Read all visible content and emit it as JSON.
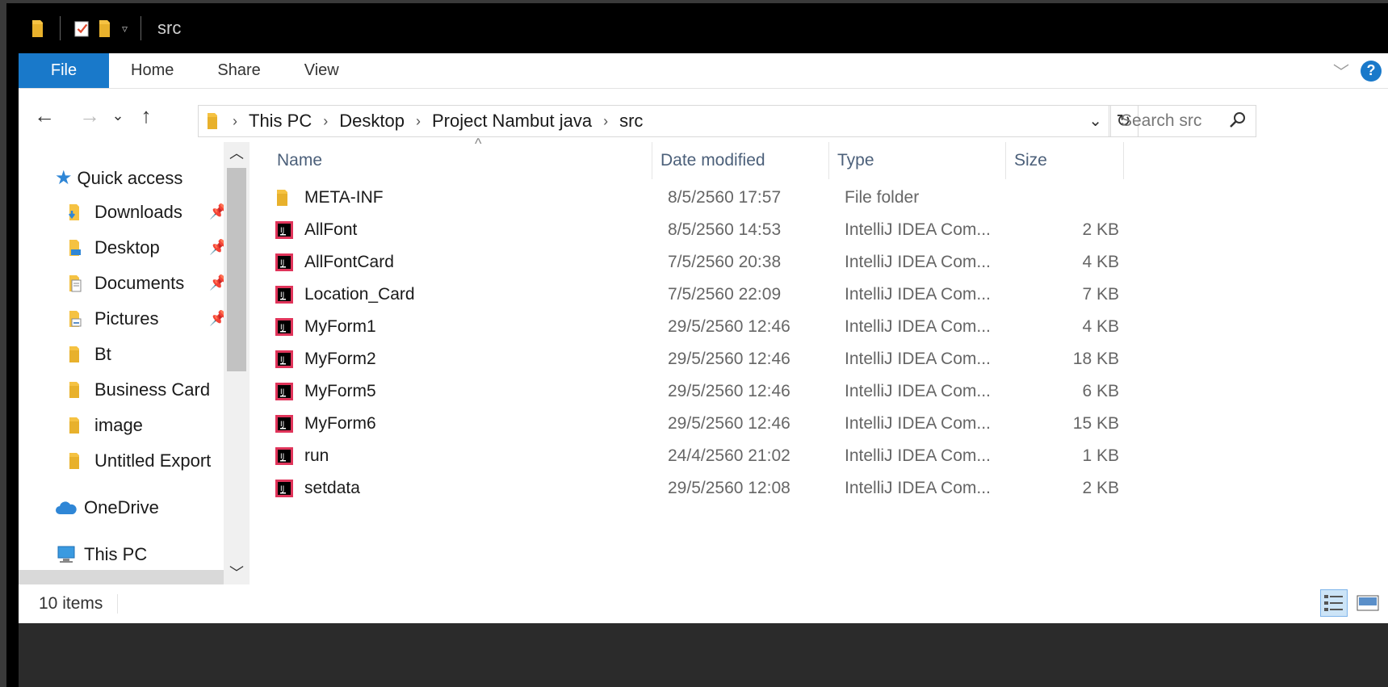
{
  "window": {
    "title": "src"
  },
  "ribbon": {
    "tabs": [
      {
        "label": "File"
      },
      {
        "label": "Home"
      },
      {
        "label": "Share"
      },
      {
        "label": "View"
      }
    ],
    "help_label": "?"
  },
  "address": {
    "breadcrumbs": [
      "This PC",
      "Desktop",
      "Project Nambut java",
      "src"
    ]
  },
  "search": {
    "placeholder": "Search src"
  },
  "nav": {
    "quick_access": "Quick access",
    "items": [
      {
        "label": "Downloads",
        "pinned": true,
        "icon": "downloads-folder-icon"
      },
      {
        "label": "Desktop",
        "pinned": true,
        "icon": "desktop-folder-icon"
      },
      {
        "label": "Documents",
        "pinned": true,
        "icon": "documents-folder-icon"
      },
      {
        "label": "Pictures",
        "pinned": true,
        "icon": "pictures-folder-icon"
      },
      {
        "label": "Bt",
        "pinned": false,
        "icon": "folder-icon"
      },
      {
        "label": "Business Card",
        "pinned": false,
        "icon": "folder-icon"
      },
      {
        "label": "image",
        "pinned": false,
        "icon": "folder-icon"
      },
      {
        "label": "Untitled Export",
        "pinned": false,
        "icon": "folder-icon"
      }
    ],
    "onedrive": "OneDrive",
    "this_pc": "This PC"
  },
  "columns": {
    "name": "Name",
    "date": "Date modified",
    "type": "Type",
    "size": "Size"
  },
  "files": [
    {
      "name": "META-INF",
      "date": "8/5/2560 17:57",
      "type": "File folder",
      "size": "",
      "icon": "folder-icon"
    },
    {
      "name": "AllFont",
      "date": "8/5/2560 14:53",
      "type": "IntelliJ IDEA Com...",
      "size": "2 KB",
      "icon": "intellij-file-icon"
    },
    {
      "name": "AllFontCard",
      "date": "7/5/2560 20:38",
      "type": "IntelliJ IDEA Com...",
      "size": "4 KB",
      "icon": "intellij-file-icon"
    },
    {
      "name": "Location_Card",
      "date": "7/5/2560 22:09",
      "type": "IntelliJ IDEA Com...",
      "size": "7 KB",
      "icon": "intellij-file-icon"
    },
    {
      "name": "MyForm1",
      "date": "29/5/2560 12:46",
      "type": "IntelliJ IDEA Com...",
      "size": "4 KB",
      "icon": "intellij-file-icon"
    },
    {
      "name": "MyForm2",
      "date": "29/5/2560 12:46",
      "type": "IntelliJ IDEA Com...",
      "size": "18 KB",
      "icon": "intellij-file-icon"
    },
    {
      "name": "MyForm5",
      "date": "29/5/2560 12:46",
      "type": "IntelliJ IDEA Com...",
      "size": "6 KB",
      "icon": "intellij-file-icon"
    },
    {
      "name": "MyForm6",
      "date": "29/5/2560 12:46",
      "type": "IntelliJ IDEA Com...",
      "size": "15 KB",
      "icon": "intellij-file-icon"
    },
    {
      "name": "run",
      "date": "24/4/2560 21:02",
      "type": "IntelliJ IDEA Com...",
      "size": "1 KB",
      "icon": "intellij-file-icon"
    },
    {
      "name": "setdata",
      "date": "29/5/2560 12:08",
      "type": "IntelliJ IDEA Com...",
      "size": "2 KB",
      "icon": "intellij-file-icon"
    }
  ],
  "status": {
    "item_count": "10 items"
  },
  "colors": {
    "accent": "#1979ca",
    "folder": "#f5c242",
    "header_text": "#4c607a"
  }
}
